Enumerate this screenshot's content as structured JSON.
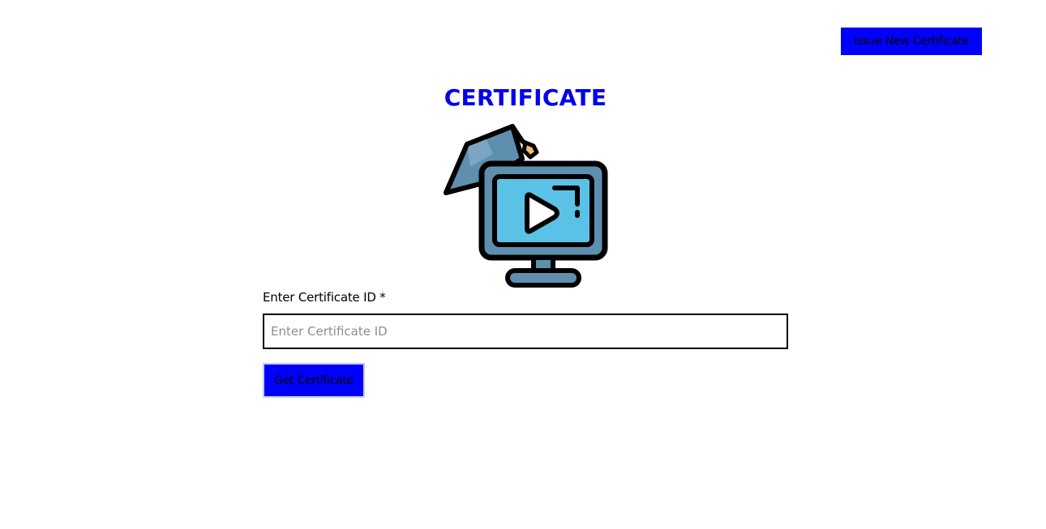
{
  "header": {
    "issue_button_label": "Issue New Certificate"
  },
  "main": {
    "title": "CERTIFICATE",
    "hero_icon": "graduation-cap-monitor-play-icon",
    "form": {
      "label": "Enter Certificate ID *",
      "input_placeholder": "Enter Certificate ID",
      "input_value": "",
      "submit_label": "Get Certificate"
    }
  },
  "colors": {
    "accent": "#0000ff",
    "title": "#0000ee",
    "background": "#ffffff",
    "icon_screen": "#5bc2e7",
    "icon_body": "#5f8fae",
    "icon_tassel": "#f5b971"
  }
}
